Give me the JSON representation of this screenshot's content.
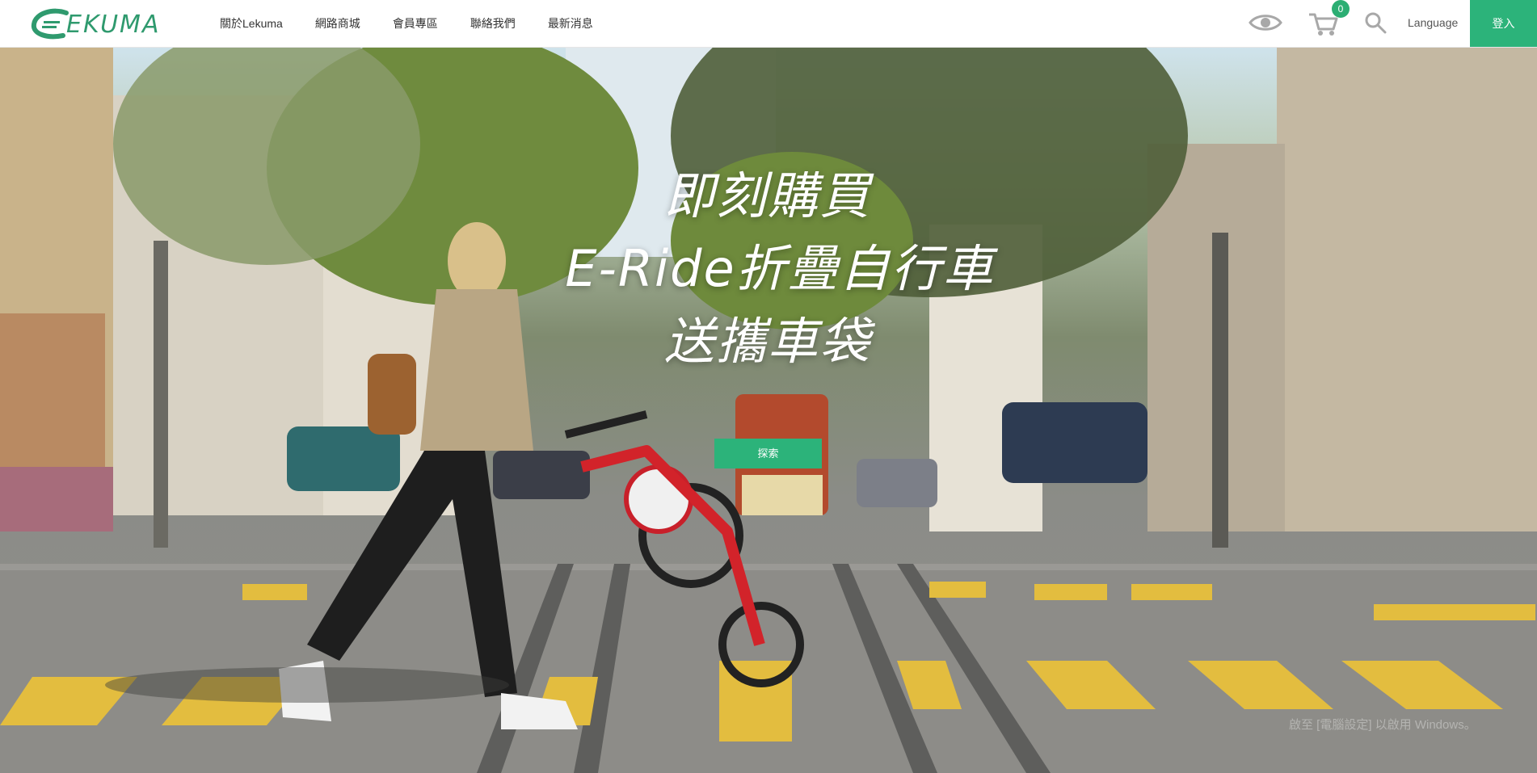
{
  "brand": {
    "name": "EKUMA",
    "accent": "#2cb37a"
  },
  "nav": {
    "items": [
      {
        "label": "關於Lekuma"
      },
      {
        "label": "網路商城"
      },
      {
        "label": "會員專區"
      },
      {
        "label": "聯絡我們"
      },
      {
        "label": "最新消息"
      }
    ]
  },
  "toolbar": {
    "view_icon": "eye-icon",
    "cart_icon": "cart-icon",
    "cart_count": "0",
    "search_icon": "search-icon",
    "language_label": "Language",
    "login_label": "登入"
  },
  "hero": {
    "headline": [
      "即刻購買",
      "E-Ride折疊自行車",
      "送攜車袋"
    ],
    "cta_label": "探索",
    "watermark": "啟至 [電腦設定] 以啟用 Windows。"
  }
}
